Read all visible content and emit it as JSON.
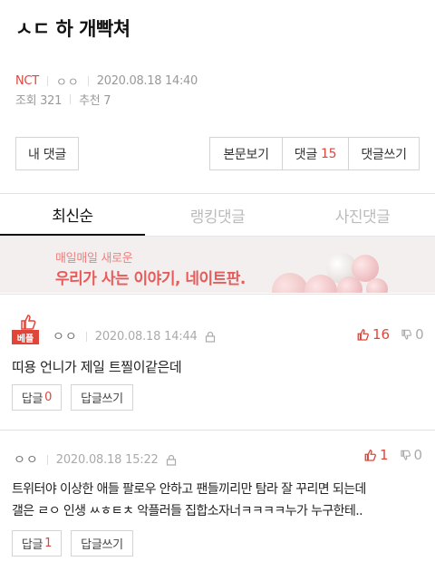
{
  "post": {
    "title": "ㅅㄷ 하 개빡쳐",
    "category": "NCT",
    "author": "ㅇㅇ",
    "datetime": "2020.08.18 14:40",
    "views": "조회 321",
    "recommends": "추천 7"
  },
  "actions": {
    "my_comment": "내 댓글",
    "view_body": "본문보기",
    "comments_label": "댓글",
    "comments_count": "15",
    "write_comment": "댓글쓰기"
  },
  "tabs": [
    {
      "label": "최신순",
      "active": true
    },
    {
      "label": "랭킹댓글",
      "active": false
    },
    {
      "label": "사진댓글",
      "active": false
    }
  ],
  "banner": {
    "line1": "매일매일 새로운",
    "line2": "우리가 사는 이야기, 네이트판."
  },
  "comments": [
    {
      "best": true,
      "best_label": "베플",
      "author": "ㅇㅇ",
      "datetime": "2020.08.18 14:44",
      "up": "16",
      "down": "0",
      "text": "띠용 언니가 제일 트찔이같은데",
      "reply_label": "답글",
      "reply_count": "0",
      "write_reply": "답글쓰기"
    },
    {
      "best": false,
      "author": "ㅇㅇ",
      "datetime": "2020.08.18 15:22",
      "up": "1",
      "down": "0",
      "text_line1": "트위터야 이상한 애들 팔로우 안하고 팬들끼리만 탐라 잘 꾸리면 되는데",
      "text_line2": "갤은 ㄹㅇ 인생 ㅆㅎㅌㅊ 악플러들 집합소자너ㅋㅋㅋㅋ누가 누구한테..",
      "reply_label": "답글",
      "reply_count": "1",
      "write_reply": "답글쓰기"
    }
  ],
  "colors": {
    "accent": "#e0453a",
    "muted": "#999999",
    "banner_bg": "#f3efef"
  }
}
